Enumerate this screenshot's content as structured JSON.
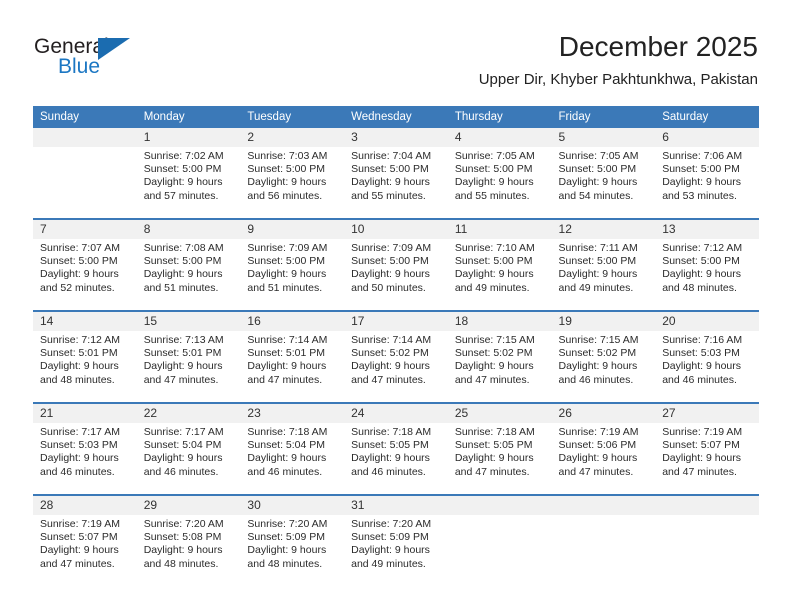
{
  "brand": {
    "name_top": "General",
    "name_bottom": "Blue",
    "triangle_color": "#1b6cb0",
    "blue_text_color": "#1c77c3"
  },
  "header": {
    "title": "December 2025",
    "subtitle": "Upper Dir, Khyber Pakhtunkhwa, Pakistan"
  },
  "theme": {
    "header_band": "#3b79b8",
    "daynum_band": "#f1f1f1",
    "text": "#2b2b2b"
  },
  "weekdays": [
    "Sunday",
    "Monday",
    "Tuesday",
    "Wednesday",
    "Thursday",
    "Friday",
    "Saturday"
  ],
  "weeks": [
    [
      {
        "day": "",
        "sunrise": "",
        "sunset": "",
        "daylight1": "",
        "daylight2": ""
      },
      {
        "day": "1",
        "sunrise": "Sunrise: 7:02 AM",
        "sunset": "Sunset: 5:00 PM",
        "daylight1": "Daylight: 9 hours",
        "daylight2": "and 57 minutes."
      },
      {
        "day": "2",
        "sunrise": "Sunrise: 7:03 AM",
        "sunset": "Sunset: 5:00 PM",
        "daylight1": "Daylight: 9 hours",
        "daylight2": "and 56 minutes."
      },
      {
        "day": "3",
        "sunrise": "Sunrise: 7:04 AM",
        "sunset": "Sunset: 5:00 PM",
        "daylight1": "Daylight: 9 hours",
        "daylight2": "and 55 minutes."
      },
      {
        "day": "4",
        "sunrise": "Sunrise: 7:05 AM",
        "sunset": "Sunset: 5:00 PM",
        "daylight1": "Daylight: 9 hours",
        "daylight2": "and 55 minutes."
      },
      {
        "day": "5",
        "sunrise": "Sunrise: 7:05 AM",
        "sunset": "Sunset: 5:00 PM",
        "daylight1": "Daylight: 9 hours",
        "daylight2": "and 54 minutes."
      },
      {
        "day": "6",
        "sunrise": "Sunrise: 7:06 AM",
        "sunset": "Sunset: 5:00 PM",
        "daylight1": "Daylight: 9 hours",
        "daylight2": "and 53 minutes."
      }
    ],
    [
      {
        "day": "7",
        "sunrise": "Sunrise: 7:07 AM",
        "sunset": "Sunset: 5:00 PM",
        "daylight1": "Daylight: 9 hours",
        "daylight2": "and 52 minutes."
      },
      {
        "day": "8",
        "sunrise": "Sunrise: 7:08 AM",
        "sunset": "Sunset: 5:00 PM",
        "daylight1": "Daylight: 9 hours",
        "daylight2": "and 51 minutes."
      },
      {
        "day": "9",
        "sunrise": "Sunrise: 7:09 AM",
        "sunset": "Sunset: 5:00 PM",
        "daylight1": "Daylight: 9 hours",
        "daylight2": "and 51 minutes."
      },
      {
        "day": "10",
        "sunrise": "Sunrise: 7:09 AM",
        "sunset": "Sunset: 5:00 PM",
        "daylight1": "Daylight: 9 hours",
        "daylight2": "and 50 minutes."
      },
      {
        "day": "11",
        "sunrise": "Sunrise: 7:10 AM",
        "sunset": "Sunset: 5:00 PM",
        "daylight1": "Daylight: 9 hours",
        "daylight2": "and 49 minutes."
      },
      {
        "day": "12",
        "sunrise": "Sunrise: 7:11 AM",
        "sunset": "Sunset: 5:00 PM",
        "daylight1": "Daylight: 9 hours",
        "daylight2": "and 49 minutes."
      },
      {
        "day": "13",
        "sunrise": "Sunrise: 7:12 AM",
        "sunset": "Sunset: 5:00 PM",
        "daylight1": "Daylight: 9 hours",
        "daylight2": "and 48 minutes."
      }
    ],
    [
      {
        "day": "14",
        "sunrise": "Sunrise: 7:12 AM",
        "sunset": "Sunset: 5:01 PM",
        "daylight1": "Daylight: 9 hours",
        "daylight2": "and 48 minutes."
      },
      {
        "day": "15",
        "sunrise": "Sunrise: 7:13 AM",
        "sunset": "Sunset: 5:01 PM",
        "daylight1": "Daylight: 9 hours",
        "daylight2": "and 47 minutes."
      },
      {
        "day": "16",
        "sunrise": "Sunrise: 7:14 AM",
        "sunset": "Sunset: 5:01 PM",
        "daylight1": "Daylight: 9 hours",
        "daylight2": "and 47 minutes."
      },
      {
        "day": "17",
        "sunrise": "Sunrise: 7:14 AM",
        "sunset": "Sunset: 5:02 PM",
        "daylight1": "Daylight: 9 hours",
        "daylight2": "and 47 minutes."
      },
      {
        "day": "18",
        "sunrise": "Sunrise: 7:15 AM",
        "sunset": "Sunset: 5:02 PM",
        "daylight1": "Daylight: 9 hours",
        "daylight2": "and 47 minutes."
      },
      {
        "day": "19",
        "sunrise": "Sunrise: 7:15 AM",
        "sunset": "Sunset: 5:02 PM",
        "daylight1": "Daylight: 9 hours",
        "daylight2": "and 46 minutes."
      },
      {
        "day": "20",
        "sunrise": "Sunrise: 7:16 AM",
        "sunset": "Sunset: 5:03 PM",
        "daylight1": "Daylight: 9 hours",
        "daylight2": "and 46 minutes."
      }
    ],
    [
      {
        "day": "21",
        "sunrise": "Sunrise: 7:17 AM",
        "sunset": "Sunset: 5:03 PM",
        "daylight1": "Daylight: 9 hours",
        "daylight2": "and 46 minutes."
      },
      {
        "day": "22",
        "sunrise": "Sunrise: 7:17 AM",
        "sunset": "Sunset: 5:04 PM",
        "daylight1": "Daylight: 9 hours",
        "daylight2": "and 46 minutes."
      },
      {
        "day": "23",
        "sunrise": "Sunrise: 7:18 AM",
        "sunset": "Sunset: 5:04 PM",
        "daylight1": "Daylight: 9 hours",
        "daylight2": "and 46 minutes."
      },
      {
        "day": "24",
        "sunrise": "Sunrise: 7:18 AM",
        "sunset": "Sunset: 5:05 PM",
        "daylight1": "Daylight: 9 hours",
        "daylight2": "and 46 minutes."
      },
      {
        "day": "25",
        "sunrise": "Sunrise: 7:18 AM",
        "sunset": "Sunset: 5:05 PM",
        "daylight1": "Daylight: 9 hours",
        "daylight2": "and 47 minutes."
      },
      {
        "day": "26",
        "sunrise": "Sunrise: 7:19 AM",
        "sunset": "Sunset: 5:06 PM",
        "daylight1": "Daylight: 9 hours",
        "daylight2": "and 47 minutes."
      },
      {
        "day": "27",
        "sunrise": "Sunrise: 7:19 AM",
        "sunset": "Sunset: 5:07 PM",
        "daylight1": "Daylight: 9 hours",
        "daylight2": "and 47 minutes."
      }
    ],
    [
      {
        "day": "28",
        "sunrise": "Sunrise: 7:19 AM",
        "sunset": "Sunset: 5:07 PM",
        "daylight1": "Daylight: 9 hours",
        "daylight2": "and 47 minutes."
      },
      {
        "day": "29",
        "sunrise": "Sunrise: 7:20 AM",
        "sunset": "Sunset: 5:08 PM",
        "daylight1": "Daylight: 9 hours",
        "daylight2": "and 48 minutes."
      },
      {
        "day": "30",
        "sunrise": "Sunrise: 7:20 AM",
        "sunset": "Sunset: 5:09 PM",
        "daylight1": "Daylight: 9 hours",
        "daylight2": "and 48 minutes."
      },
      {
        "day": "31",
        "sunrise": "Sunrise: 7:20 AM",
        "sunset": "Sunset: 5:09 PM",
        "daylight1": "Daylight: 9 hours",
        "daylight2": "and 49 minutes."
      },
      {
        "day": "",
        "sunrise": "",
        "sunset": "",
        "daylight1": "",
        "daylight2": ""
      },
      {
        "day": "",
        "sunrise": "",
        "sunset": "",
        "daylight1": "",
        "daylight2": ""
      },
      {
        "day": "",
        "sunrise": "",
        "sunset": "",
        "daylight1": "",
        "daylight2": ""
      }
    ]
  ]
}
